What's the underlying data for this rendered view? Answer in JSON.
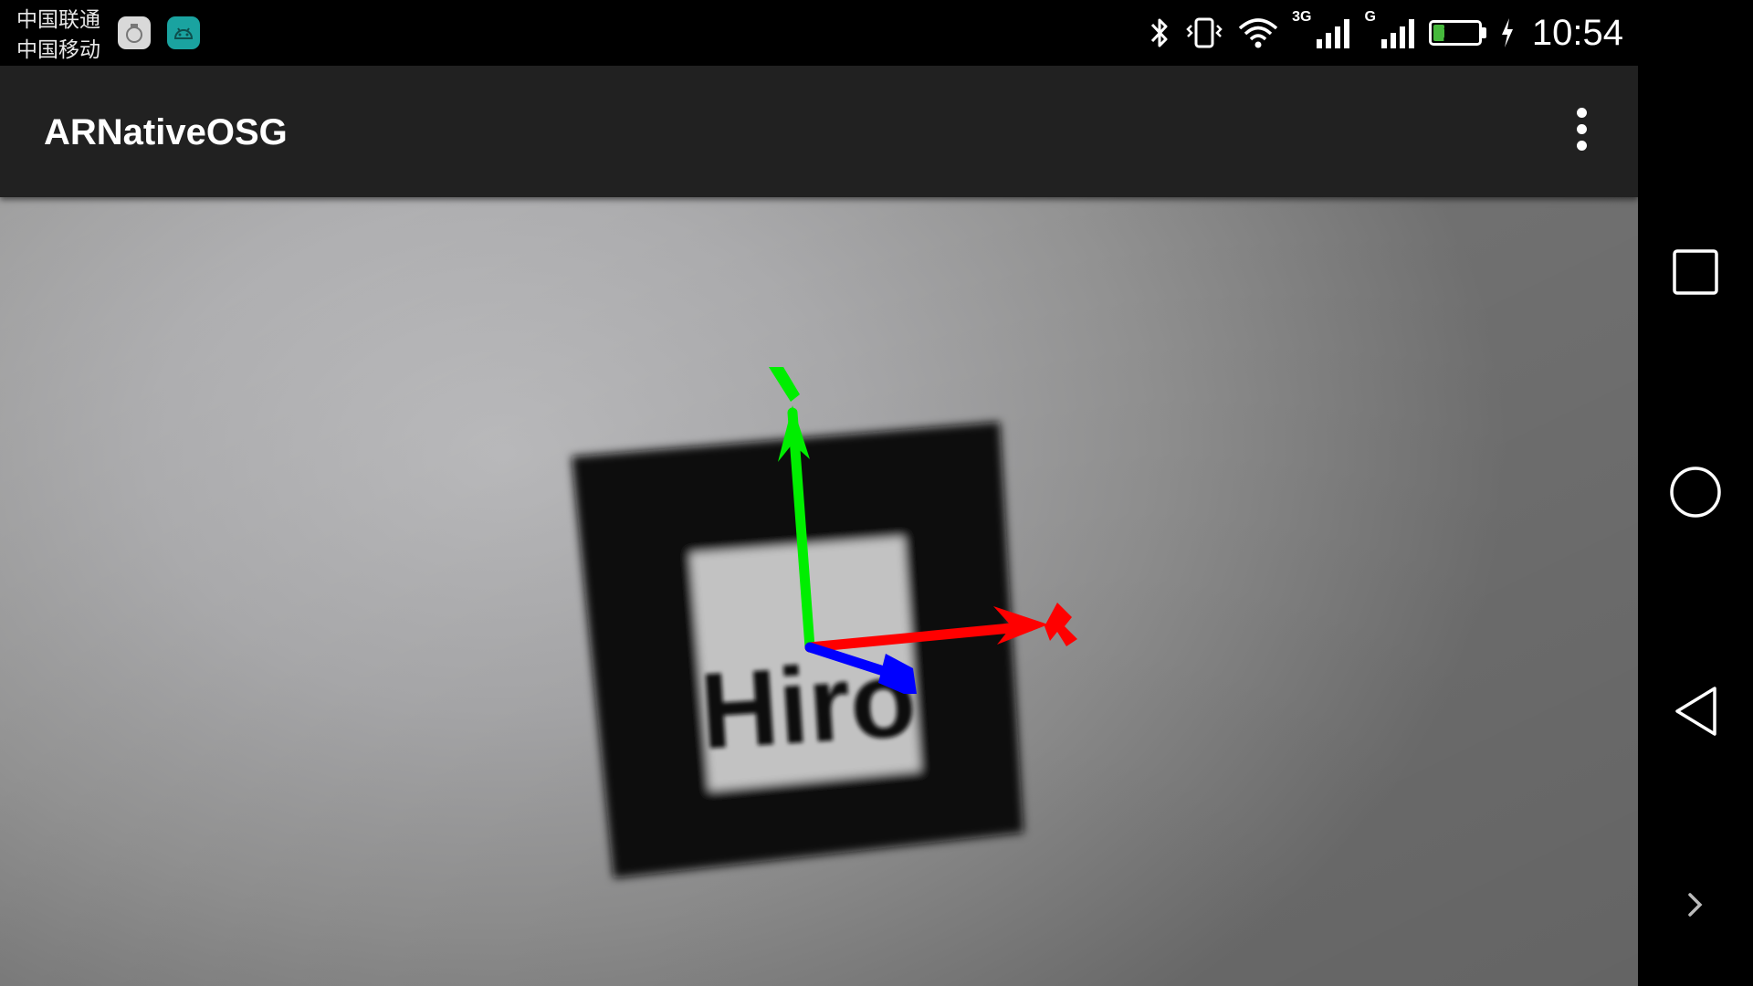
{
  "status_bar": {
    "carriers": [
      "中国联通",
      "中国移动"
    ],
    "notification_icons": [
      "app-notification-icon",
      "android-debug-icon"
    ],
    "icons": [
      "bluetooth-icon",
      "vibrate-icon",
      "wifi-icon",
      "signal-3g-icon",
      "signal-g-icon",
      "battery-icon",
      "charging-icon"
    ],
    "net_3g": "3G",
    "net_g": "G",
    "battery_level": "24",
    "battery_fraction": 0.24,
    "time": "10:54"
  },
  "app_bar": {
    "title": "ARNativeOSG",
    "menu_icon": "overflow-menu-icon"
  },
  "camera": {
    "marker_text": "Hiro",
    "axes": [
      {
        "axis": "x",
        "color": "#ff0000"
      },
      {
        "axis": "y",
        "color": "#00ee00"
      },
      {
        "axis": "z",
        "color": "#0000ff"
      }
    ]
  },
  "nav_bar": {
    "buttons": [
      "recent-apps-icon",
      "home-icon",
      "back-icon",
      "expand-chevron-icon"
    ]
  },
  "colors": {
    "status_bg": "#000000",
    "app_bar_bg": "#212121",
    "battery_green": "#46b93c"
  }
}
